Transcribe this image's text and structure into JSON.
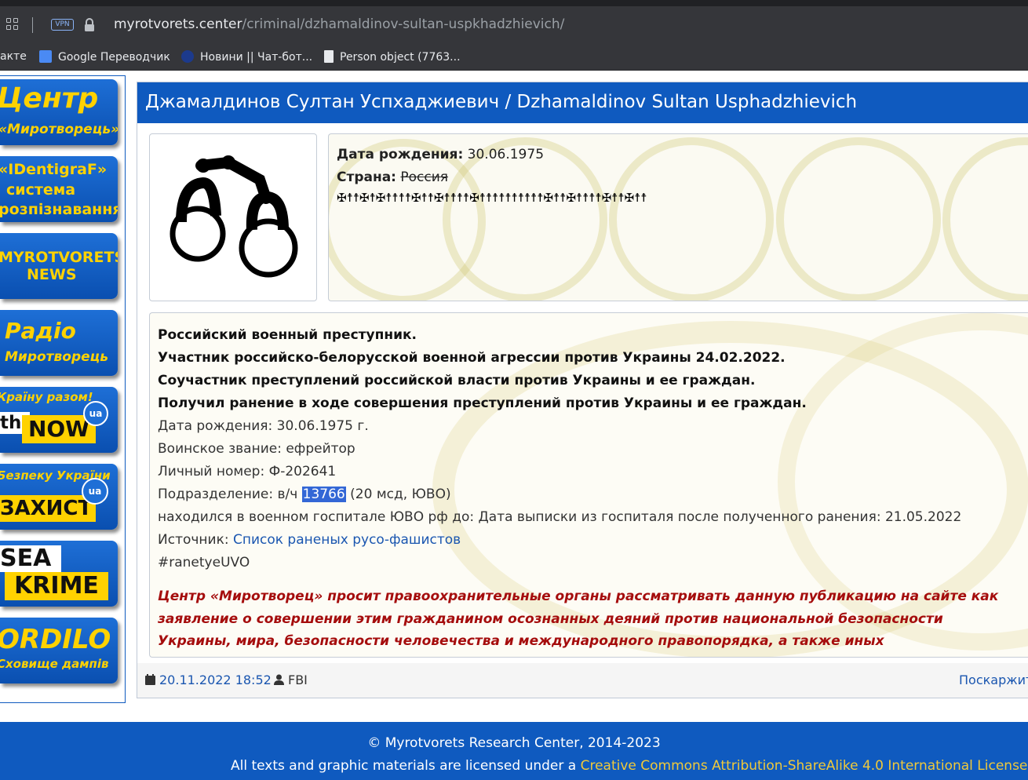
{
  "browser": {
    "vpn_label": "VPN",
    "url_host": "myrotvorets.center",
    "url_path": "/criminal/dzhamaldinov-sultan-uspkhadzhievich/",
    "bookmarks": [
      {
        "label": "актe"
      },
      {
        "label": "Google Переводчик"
      },
      {
        "label": "Новини || Чат-бот..."
      },
      {
        "label": "Person object (7763..."
      }
    ]
  },
  "sidebar": {
    "items": [
      {
        "line1": "Центр",
        "line2": "«Миротворець»"
      },
      {
        "line1": "«IDentigraF»",
        "line2": "система",
        "line3": "розпізнавання"
      },
      {
        "line1": "MYROTVORETS",
        "line2": "NEWS"
      },
      {
        "line1": "Радіо",
        "line2": "Миротворець"
      },
      {
        "line1": "Країну разом!",
        "line2": "the",
        "line3": "NOW",
        "badge": "ua"
      },
      {
        "line1": "Безпеку України",
        "line2": "ЗАХИСТ",
        "badge": "ua"
      },
      {
        "line1": "SEA",
        "line2": "KRIME"
      },
      {
        "line1": "ORDILO",
        "line2": "Сховище дампів"
      }
    ]
  },
  "article": {
    "title": "Джамалдинов Султан Успхаджиевич / Dzhamaldinov Sultan Usphadzhievich",
    "info": {
      "birth_label": "Дата рождения:",
      "birth_value": "30.06.1975",
      "country_label": "Страна:",
      "country_value": "Россия",
      "crosses": "✠☨☨✠☨✠☨☨☨☨✠☨☨✠☨☨☨☨✠☨☨☨☨☨☨☨☨☨☨✠☨☨✠☨☨☨☨✠☨☨✠☨☨"
    },
    "desc": {
      "bold_lines": [
        "Российский военный преступник.",
        "Участник российско-белорусской военной агрессии против Украины 24.02.2022.",
        "Соучастник преступлений российской власти против Украины и ее граждан.",
        "Получил ранение в ходе совершения преступлений против Украины и ее граждан."
      ],
      "birth": "Дата рождения: 30.06.1975 г.",
      "rank": "Воинское звание: ефрейтор",
      "personal_no": "Личный номер: Ф-202641",
      "unit_prefix": "Подразделение: в/ч ",
      "unit_number": "13766",
      "unit_suffix": " (20 мсд, ЮВО)",
      "hospital": "находился в военном госпитале ЮВО рф до: Дата выписки из госпиталя после полученного ранения: 21.05.2022",
      "source_label": "Источник: ",
      "source_link": "Список раненых русо-фашистов",
      "hashtag": "#ranetyeUVO",
      "warning": "Центр «Миротворец» просит правоохранительные органы рассматривать данную публикацию на сайте как заявление о совершении этим гражданином осознанных деяний против национальной безопасности Украины, мира, безопасности человечества и международного правопорядка, а также иных правонарушений."
    },
    "meta": {
      "date": "20.11.2022 18:52",
      "author": "FBI",
      "complain": "Поскаржит"
    }
  },
  "footer": {
    "copyright": "© Myrotvorets Research Center, 2014-2023",
    "license_prefix": "All texts and graphic materials are licensed under a ",
    "license_link": "Creative Commons Attribution-ShareAlike 4.0 International License",
    "license_suffix": "."
  },
  "colors": {
    "brand_blue": "#0f5abf",
    "sidebar_yellow": "#ffd200",
    "warning_red": "#a50d0d",
    "link": "#1a56b0",
    "footer_link": "#f0c93a"
  }
}
